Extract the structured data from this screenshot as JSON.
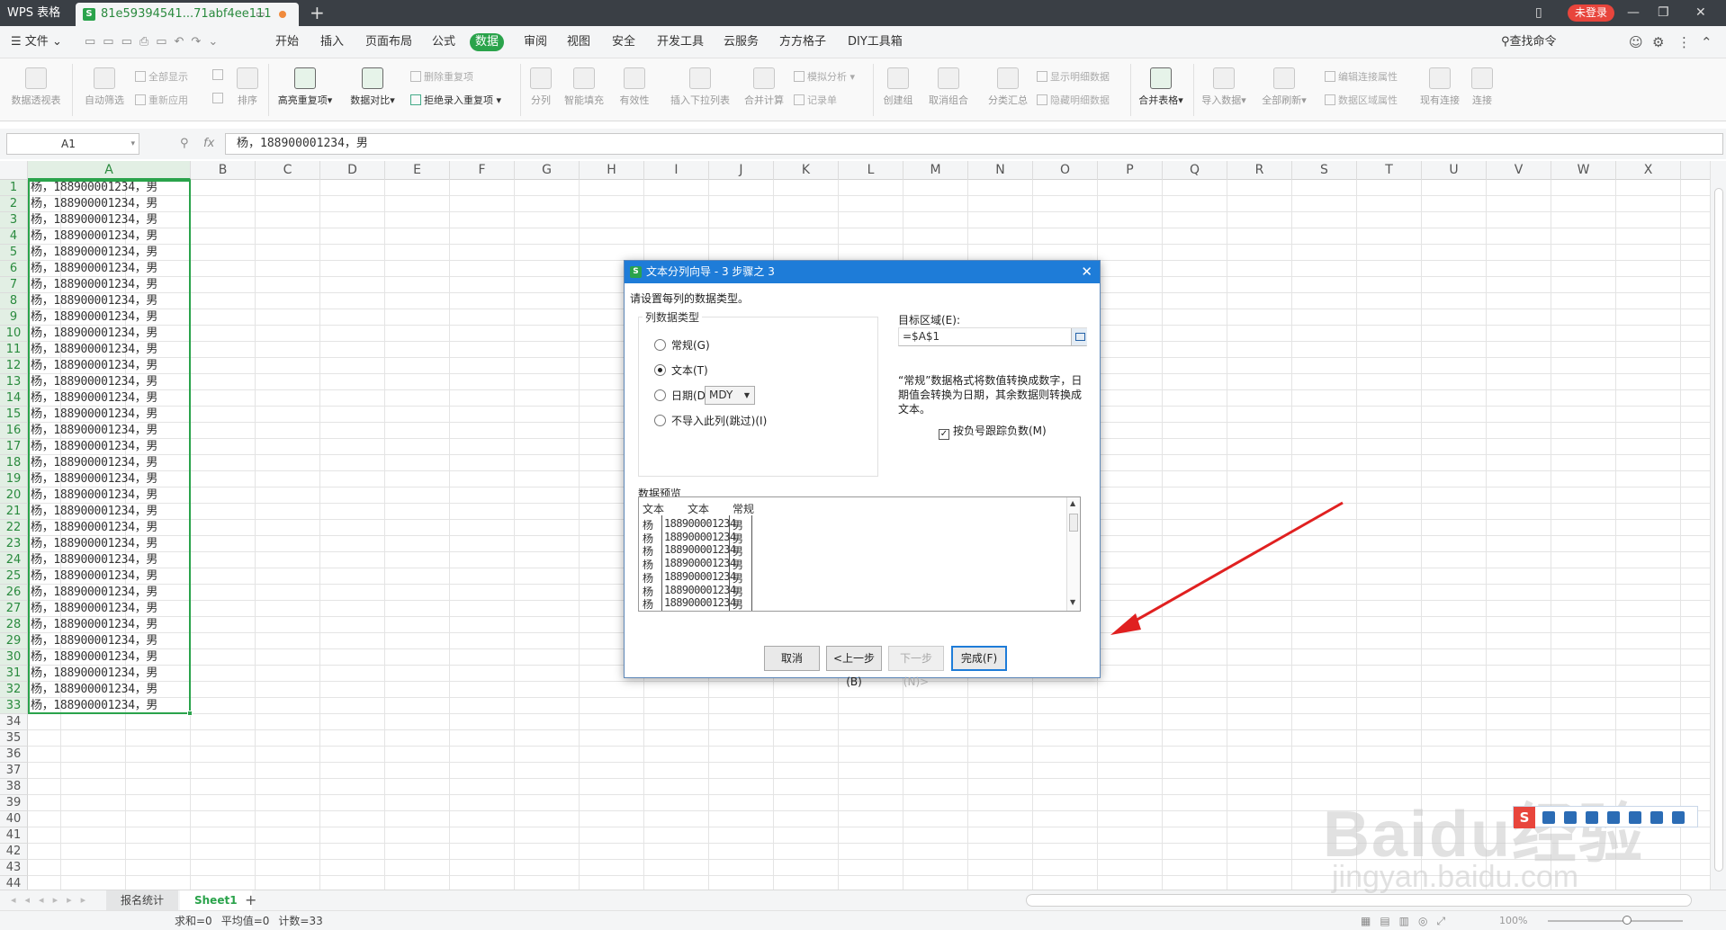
{
  "titlebar": {
    "app_name": "WPS 表格",
    "doc_tab": "81e59394541...71abf4ee111",
    "login": "未登录"
  },
  "menubar": {
    "file": "文件",
    "tabs": [
      "开始",
      "插入",
      "页面布局",
      "公式",
      "数据",
      "审阅",
      "视图",
      "安全",
      "开发工具",
      "云服务",
      "方方格子",
      "DIY工具箱"
    ],
    "active_tab": "数据",
    "search": "查找命令"
  },
  "ribbon": {
    "pivot": "数据透视表",
    "auto_filter": "自动筛选",
    "show_all": "全部显示",
    "reapply": "重新应用",
    "sort": "排序",
    "highlight_dup": "高亮重复项",
    "compare": "数据对比",
    "delete_dup": "删除重复项",
    "reject_dup": "拒绝录入重复项",
    "split_col": "分列",
    "smart_fill": "智能填充",
    "validity": "有效性",
    "insert_dropdown": "插入下拉列表",
    "consolidate": "合并计算",
    "simulate": "模拟分析",
    "record": "记录单",
    "create_group": "创建组",
    "ungroup": "取消组合",
    "subtotal": "分类汇总",
    "show_detail": "显示明细数据",
    "hide_detail": "隐藏明细数据",
    "merge_table": "合并表格",
    "import_data": "导入数据",
    "refresh_all": "全部刷新",
    "edit_link": "编辑连接属性",
    "range_prop": "数据区域属性",
    "existing_conn": "现有连接",
    "connect": "连接"
  },
  "formula_bar": {
    "name_box": "A1",
    "fx": "fx",
    "formula": "杨，188900001234，男"
  },
  "grid": {
    "columns": [
      "A",
      "B",
      "C",
      "D",
      "E",
      "F",
      "G",
      "H",
      "I",
      "J",
      "K",
      "L",
      "M",
      "N",
      "O",
      "P",
      "Q",
      "R",
      "S",
      "T",
      "U",
      "V",
      "W",
      "X"
    ],
    "rows": [
      "1",
      "2",
      "3",
      "4",
      "5",
      "6",
      "7",
      "8",
      "9",
      "10",
      "11",
      "12",
      "13",
      "14",
      "15",
      "16",
      "17",
      "18",
      "19",
      "20",
      "21",
      "22",
      "23",
      "24",
      "25",
      "26",
      "27",
      "28",
      "29",
      "30",
      "31",
      "32",
      "33",
      "34",
      "35",
      "36",
      "37",
      "38",
      "39",
      "40",
      "41",
      "42",
      "43",
      "44"
    ],
    "cell_value": "杨，188900001234，男",
    "filled_rows": 33
  },
  "sheets": {
    "tabs": [
      "报名统计",
      "Sheet1"
    ],
    "active": "Sheet1"
  },
  "status": {
    "sum": "求和=0",
    "avg": "平均值=0",
    "count": "计数=33",
    "zoom": "100%"
  },
  "dialog": {
    "title": "文本分列向导 - 3 步骤之 3",
    "instruction": "请设置每列的数据类型。",
    "group_title": "列数据类型",
    "radio_general": "常规(G)",
    "radio_text": "文本(T)",
    "radio_date": "日期(D)",
    "date_format": "MDY",
    "radio_skip": "不导入此列(跳过)(I)",
    "selected": "文本(T)",
    "dest_label": "目标区域(E):",
    "dest_value": "=$A$1",
    "description": "“常规”数据格式将数值转换成数字，日期值会转换为日期，其余数据则转换成文本。",
    "negative_check": "按负号跟踪负数(M)",
    "negative_checked": true,
    "preview_label": "数据预览",
    "preview_headers": [
      "文本",
      "文本",
      "常规"
    ],
    "preview_rows": [
      [
        "杨",
        "188900001234",
        "男"
      ],
      [
        "杨",
        "188900001234",
        "男"
      ],
      [
        "杨",
        "188900001234",
        "男"
      ],
      [
        "杨",
        "188900001234",
        "男"
      ],
      [
        "杨",
        "188900001234",
        "男"
      ],
      [
        "杨",
        "188900001234",
        "男"
      ],
      [
        "杨",
        "188900001234",
        "男"
      ]
    ],
    "btn_cancel": "取消",
    "btn_back": "<上一步(B)",
    "btn_next": "下一步(N)>",
    "btn_finish": "完成(F)"
  },
  "watermark": {
    "brand": "Baidu经验",
    "url": "jingyan.baidu.com"
  }
}
